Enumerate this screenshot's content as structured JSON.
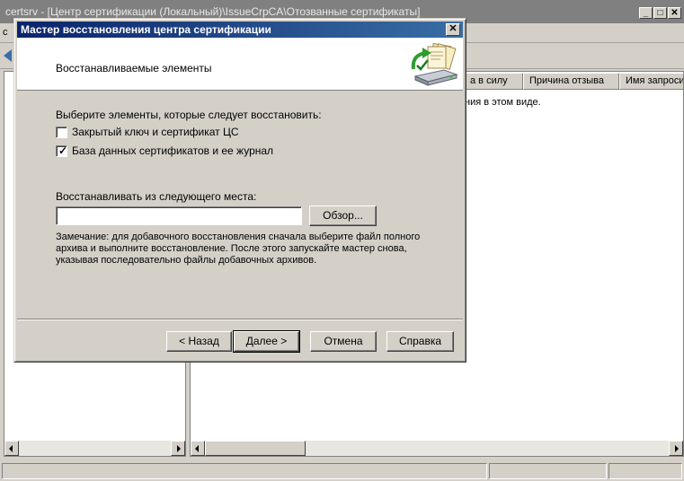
{
  "main_window": {
    "title": "certsrv - [Центр сертификации (Локальный)\\IssueCrpCA\\Отозванные сертификаты]",
    "minimize_glyph": "_",
    "maximize_glyph": "□",
    "close_glyph": "✕",
    "menu_item_visible": "с",
    "list_columns": [
      "а в силу",
      "Причина отзыва",
      "Имя запросив"
    ],
    "list_empty_text": "ния в этом виде."
  },
  "dialog": {
    "title": "Мастер восстановления центра сертификации",
    "close_glyph": "✕",
    "header_title": "Восстанавливаемые элементы",
    "header_icon": "restore-backup-icon",
    "prompt": "Выберите элементы, которые следует восстановить:",
    "options": [
      {
        "label": "Закрытый ключ и сертификат ЦС",
        "checked": false
      },
      {
        "label": "База данных сертификатов и ее журнал",
        "checked": true
      }
    ],
    "location_label": "Восстанавливать из следующего места:",
    "location_value": "",
    "browse_label": "Обзор...",
    "note": "Замечание: для добавочного восстановления сначала выберите файл полного архива и выполните восстановление. После этого запускайте мастер снова, указывая последовательно файлы добавочных архивов.",
    "buttons": {
      "back": "< Назад",
      "next": "Далее >",
      "cancel": "Отмена",
      "help": "Справка"
    }
  },
  "colors": {
    "title_active_start": "#0a246a",
    "title_active_end": "#3a6ea5",
    "title_inactive": "#808080",
    "face": "#d4d0c8"
  }
}
